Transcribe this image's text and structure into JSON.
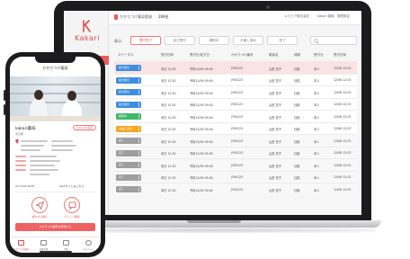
{
  "colors": {
    "accent": "#ef5b5b",
    "status_blue": "#3f8ede",
    "status_green": "#3fb86a",
    "status_orange": "#f5a623",
    "status_gray": "#9e9e9e"
  },
  "laptop": {
    "logo_text": "Kakari",
    "topbar": {
      "clinic_label": "かかりつけ薬局登録",
      "clinic_count": "289名",
      "company": "メドピア株式会社",
      "user": "kakari 薬局",
      "logout": "環境設定"
    },
    "filters": {
      "label": "表示:",
      "buttons": [
        "受付完了",
        "処方受付",
        "調剤中",
        "お渡し済み",
        "完了"
      ]
    },
    "table": {
      "headers": [
        "ステータス",
        "受付日時",
        "受付日/処方日",
        "かかりつけ番号",
        "患者名",
        "保険",
        "受付元",
        "受付日時"
      ],
      "rows": [
        {
          "status": "処方受付",
          "color": "blue",
          "c1": "本日 12:30",
          "c2": "予約12/09 09:00",
          "c3": "JY00123",
          "c4": "山田 花子",
          "c5": "社保",
          "c6": "本人",
          "c7": "12/06 12:03",
          "hl": true
        },
        {
          "status": "処方受付",
          "color": "blue",
          "c1": "本日 12:30",
          "c2": "予約12/09 09:00",
          "c3": "JY00123",
          "c4": "山田 花子",
          "c5": "社保",
          "c6": "本人",
          "c7": "12/06 12:03",
          "hl": false
        },
        {
          "status": "処方受付",
          "color": "blue",
          "c1": "本日 12:30",
          "c2": "予約12/09 09:00",
          "c3": "JY00123",
          "c4": "山田 花子",
          "c5": "社保",
          "c6": "本人",
          "c7": "12/06 12:03",
          "hl": false
        },
        {
          "status": "処方受付",
          "color": "blue",
          "c1": "本日 12:30",
          "c2": "予約12/09 09:00",
          "c3": "JY00123",
          "c4": "山田 花子",
          "c5": "社保",
          "c6": "本人",
          "c7": "12/06 12:03",
          "hl": false
        },
        {
          "status": "調剤中",
          "color": "green",
          "c1": "本日 12:30",
          "c2": "予約12/09 09:00",
          "c3": "JY00123",
          "c4": "山田 花子",
          "c5": "社保",
          "c6": "本人",
          "c7": "12/06 12:03",
          "hl": false
        },
        {
          "status": "お渡し待ち",
          "color": "orange",
          "c1": "本日 12:30",
          "c2": "予約12/09 09:00",
          "c3": "JY00123",
          "c4": "山田 花子",
          "c5": "社保",
          "c6": "本人",
          "c7": "12/06 12:03",
          "hl": false
        },
        {
          "status": "完了",
          "color": "gray",
          "c1": "本日 12:30",
          "c2": "予約12/09 09:00",
          "c3": "JY00123",
          "c4": "山田 花子",
          "c5": "社保",
          "c6": "本人",
          "c7": "12/06 12:03",
          "hl": false
        },
        {
          "status": "完了",
          "color": "gray",
          "c1": "本日 12:30",
          "c2": "予約12/09 09:00",
          "c3": "JY00123",
          "c4": "山田 花子",
          "c5": "社保",
          "c6": "本人",
          "c7": "12/06 12:03",
          "hl": false
        },
        {
          "status": "完了",
          "color": "gray",
          "c1": "本日 12:30",
          "c2": "予約12/09 09:00",
          "c3": "JY00123",
          "c4": "山田 花子",
          "c5": "社保",
          "c6": "本人",
          "c7": "12/06 12:03",
          "hl": false
        },
        {
          "status": "完了",
          "color": "gray",
          "c1": "本日 12:30",
          "c2": "予約12/09 09:00",
          "c3": "JY00123",
          "c4": "山田 花子",
          "c5": "社保",
          "c6": "本人",
          "c7": "12/06 12:03",
          "hl": false
        },
        {
          "status": "完了",
          "color": "gray",
          "c1": "本日 12:30",
          "c2": "予約12/09 09:00",
          "c3": "JY00123",
          "c4": "山田 花子",
          "c5": "社保",
          "c6": "本人",
          "c7": "12/06 12:03",
          "hl": false
        }
      ]
    }
  },
  "phone": {
    "title": "かかりつけ薬局",
    "pharmacy_name": "kakari薬局",
    "pharmacy_sub": "東京都",
    "favorite_label": "かかりつけ薬局",
    "phone_label": "03-1234-5678",
    "web_label": "Webサイトはこちら",
    "action1": "処方せん送信",
    "action2": "チャット相談",
    "cta": "かかりつけ薬局を登録する",
    "tabs": [
      "かかりつけ薬局",
      "お薬手帳",
      "予約",
      "マイページ"
    ]
  }
}
